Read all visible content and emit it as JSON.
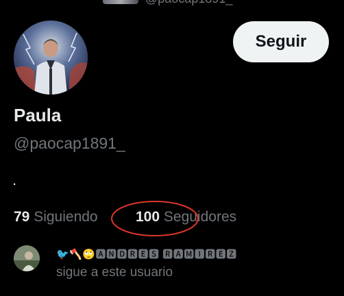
{
  "top_partial": {
    "handle_text": "@paocap1891_"
  },
  "profile": {
    "display_name": "Paula",
    "handle": "@paocap1891_",
    "bio": "."
  },
  "actions": {
    "follow_label": "Seguir"
  },
  "stats": {
    "following_count": "79",
    "following_label": "Siguiendo",
    "followers_count": "100",
    "followers_label": "Seguidores"
  },
  "followed_by": {
    "name_emojis": "🐦🪓🙄",
    "name_text": "🅰🅽🅳🆁🅴🆂 🆁🅰🅼🅸🆁🅴🆉",
    "caption": "sigue a este usuario"
  },
  "colors": {
    "background": "#000000",
    "primary_text": "#e7e9ea",
    "secondary_text": "#71767b",
    "button_bg": "#eff3f4",
    "annotation": "#e0372b"
  },
  "icons": {
    "avatar": "profile-photo",
    "mini_avatar": "follower-photo"
  }
}
